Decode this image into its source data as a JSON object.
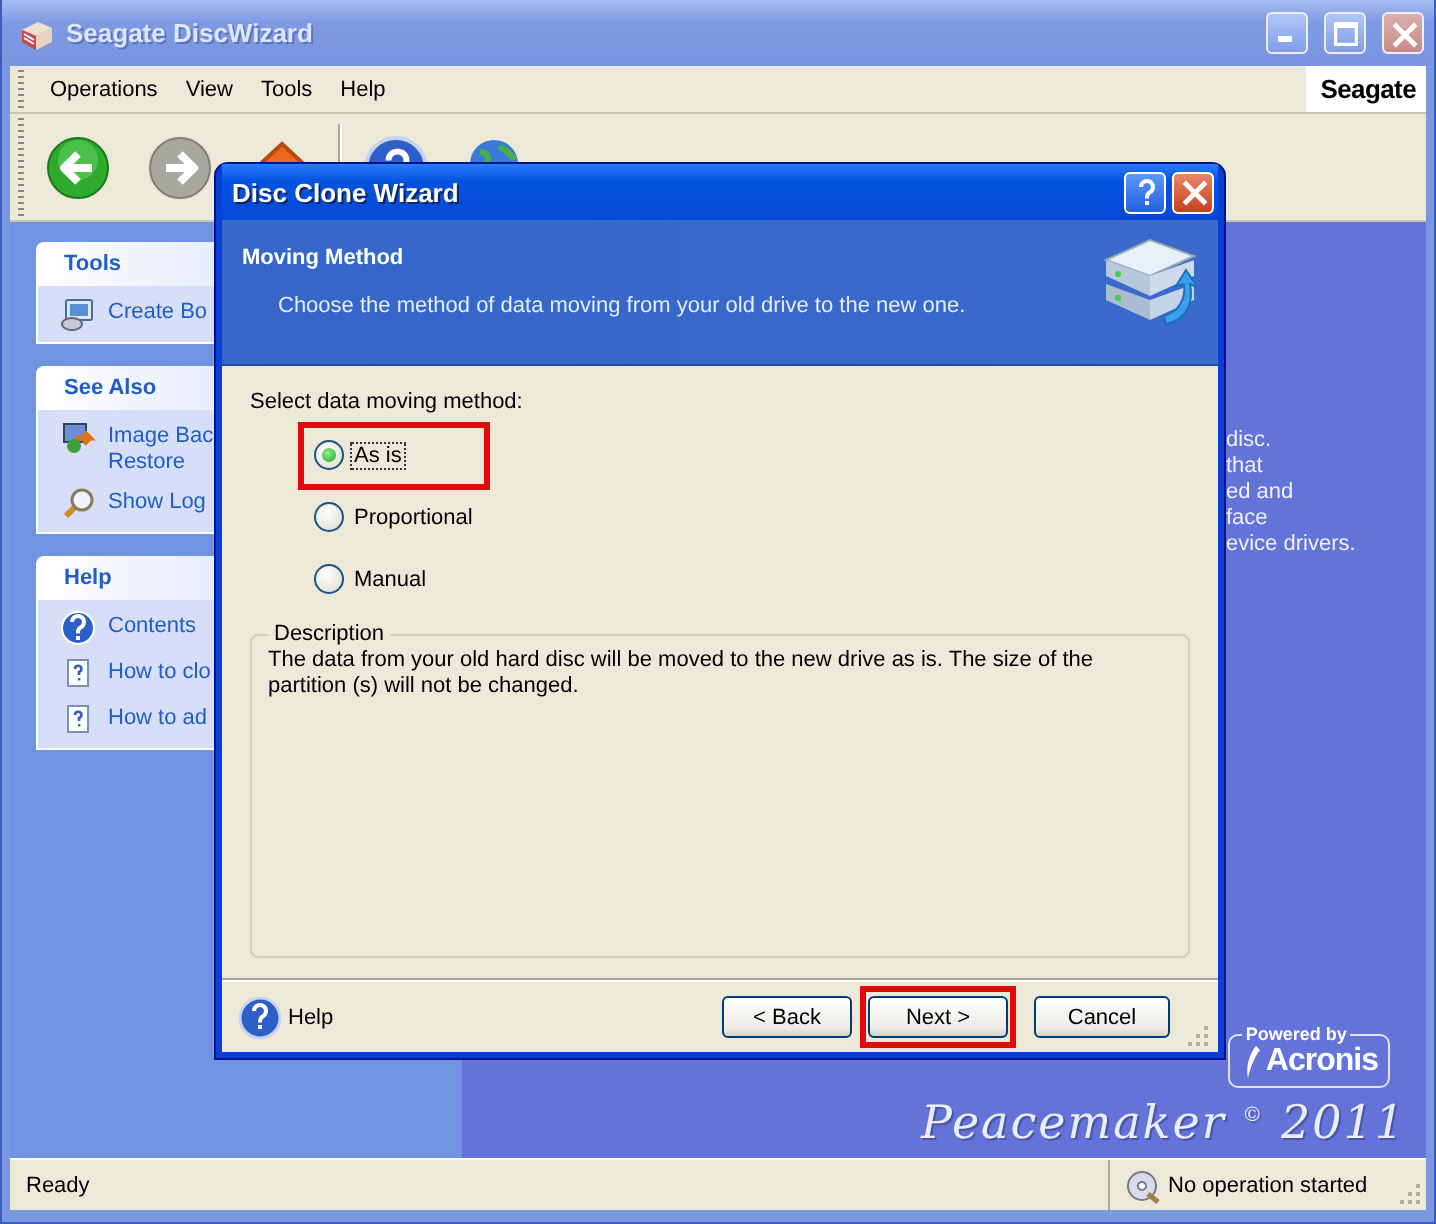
{
  "window": {
    "title": "Seagate DiscWizard"
  },
  "menu": [
    {
      "label": "Operations"
    },
    {
      "label": "View"
    },
    {
      "label": "Tools"
    },
    {
      "label": "Help"
    }
  ],
  "brand": "Seagate",
  "sidebar": [
    {
      "title": "Tools",
      "items": [
        {
          "lines": [
            "Create Bo"
          ]
        }
      ]
    },
    {
      "title": "See Also",
      "items": [
        {
          "lines": [
            "Image Bac",
            "Restore"
          ]
        },
        {
          "lines": [
            "Show Log"
          ]
        }
      ]
    },
    {
      "title": "Help",
      "items": [
        {
          "lines": [
            "Contents"
          ]
        },
        {
          "lines": [
            "How to clo"
          ]
        },
        {
          "lines": [
            "How to ad"
          ]
        }
      ]
    }
  ],
  "main_text": [
    "disc.",
    "that",
    "ed and",
    "face",
    "evice drivers."
  ],
  "badge": {
    "caption": "Powered by",
    "logo": "Acronis"
  },
  "signature": "Peacemaker $^{©}$ 2011",
  "dialog": {
    "title": "Disc Clone Wizard",
    "header": {
      "title": "Moving Method",
      "subtitle": "Choose the method of data moving from your old drive to the new one."
    },
    "prompt": "Select data moving method:",
    "options": [
      {
        "label": "As is",
        "selected": true,
        "focused": true,
        "highlighted": true
      },
      {
        "label": "Proportional",
        "selected": false,
        "focused": false,
        "highlighted": false
      },
      {
        "label": "Manual",
        "selected": false,
        "focused": false,
        "highlighted": false
      }
    ],
    "description": {
      "title": "Description",
      "text": "The data from your old hard disc will be moved to the new drive as is. The size of the partition (s) will not be changed."
    },
    "help": {
      "label": "Help"
    },
    "buttons": [
      {
        "label": "< Back",
        "highlighted": false
      },
      {
        "label": "Next >",
        "highlighted": true
      },
      {
        "label": "Cancel",
        "highlighted": false
      }
    ]
  },
  "status_bar": {
    "left": "Ready",
    "right": "No operation started"
  }
}
